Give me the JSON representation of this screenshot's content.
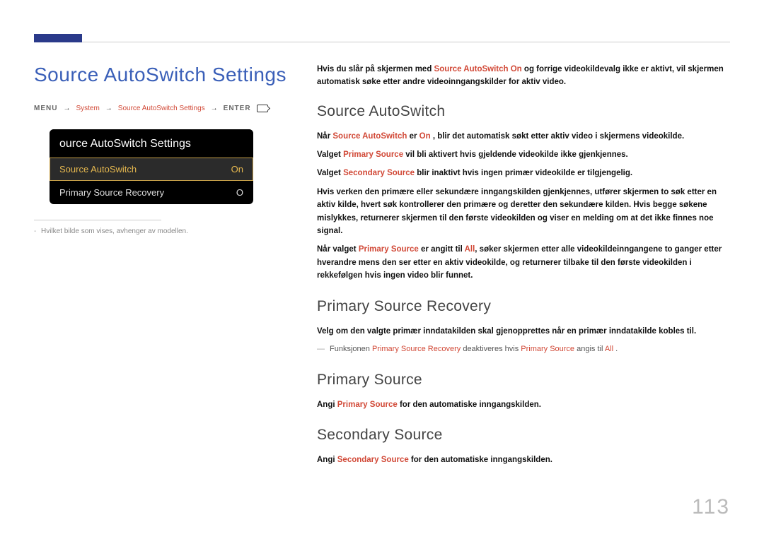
{
  "page_number": "113",
  "main_title": "Source AutoSwitch Settings",
  "breadcrumb": {
    "menu": "MENU",
    "step1": "System",
    "step2": "Source AutoSwitch Settings",
    "enter": "ENTER"
  },
  "osd": {
    "title": "ource AutoSwitch Settings",
    "row1_label": "Source AutoSwitch",
    "row1_value": "On",
    "row2_label": "Primary Source Recovery",
    "row2_value": "O"
  },
  "left_note": "Hvilket bilde som vises, avhenger av modellen.",
  "intro": {
    "pre": "Hvis du slår på skjermen med ",
    "ref": "Source AutoSwitch On",
    "post": " og forrige videokildevalg ikke er aktivt, vil skjermen automatisk søke etter andre videoinngangskilder for aktiv video."
  },
  "sections": {
    "sas": {
      "title": "Source AutoSwitch",
      "p1_pre": "Når ",
      "p1_ref1": "Source AutoSwitch",
      "p1_mid": " er ",
      "p1_ref2": "On",
      "p1_post": " , blir det automatisk søkt etter aktiv video i skjermens videokilde.",
      "p2_pre": "Valget ",
      "p2_ref": "Primary Source",
      "p2_post": " vil bli aktivert hvis gjeldende videokilde ikke gjenkjennes.",
      "p3_pre": "Valget ",
      "p3_ref": "Secondary Source",
      "p3_post": " blir inaktivt hvis ingen primær videokilde er tilgjengelig.",
      "p4": "Hvis verken den primære eller sekundære inngangskilden gjenkjennes, utfører skjermen to søk etter en aktiv kilde, hvert søk kontrollerer den primære og deretter den sekundære kilden. Hvis begge søkene mislykkes, returnerer skjermen til den første videokilden og viser en melding om at det ikke finnes noe signal.",
      "p5_pre": "Når valget ",
      "p5_ref1": "Primary Source",
      "p5_mid": " er angitt til ",
      "p5_ref2": "All",
      "p5_post": ", søker skjermen etter alle videokildeinngangene to ganger etter hverandre mens den ser etter en aktiv videokilde, og returnerer tilbake til den første videokilden i rekkefølgen hvis ingen video blir funnet."
    },
    "psr": {
      "title": "Primary Source Recovery",
      "p1": "Velg om den valgte primær inndatakilden skal gjenopprettes når en primær inndatakilde kobles til.",
      "bullet_pre": "Funksjonen ",
      "bullet_ref1": "Primary Source Recovery",
      "bullet_mid": " deaktiveres hvis ",
      "bullet_ref2": "Primary Source",
      "bullet_mid2": " angis til ",
      "bullet_ref3": "All",
      "bullet_post": " ."
    },
    "ps": {
      "title": "Primary Source",
      "p1_pre": "Angi ",
      "p1_ref": "Primary Source",
      "p1_post": " for den automatiske inngangskilden."
    },
    "ss": {
      "title": "Secondary Source",
      "p1_pre": "Angi ",
      "p1_ref": "Secondary Source",
      "p1_post": " for den automatiske inngangskilden."
    }
  }
}
